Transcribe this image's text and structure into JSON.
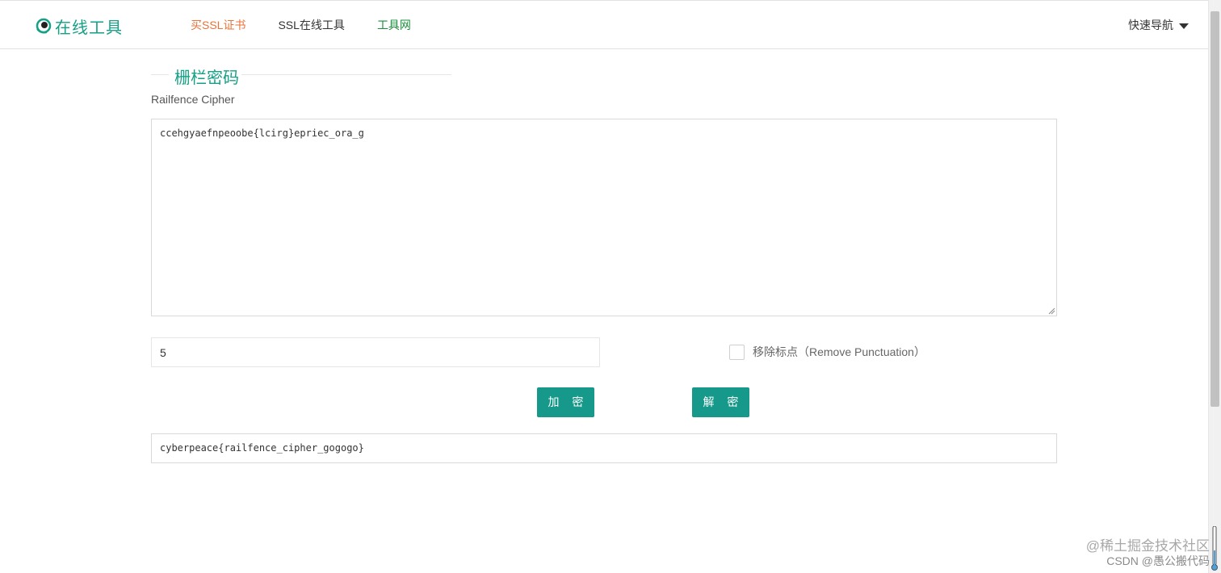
{
  "header": {
    "logo_text": "在线工具",
    "nav": [
      {
        "label": "买SSL证书",
        "color": "#e8743b"
      },
      {
        "label": "SSL在线工具",
        "color": "#333333"
      },
      {
        "label": "工具网",
        "color": "#1b8e3c"
      }
    ],
    "quick_nav_label": "快速导航"
  },
  "section": {
    "title": "栅栏密码",
    "subtitle": "Railfence Cipher"
  },
  "cipher": {
    "input_text": "ccehgyaefnpeoobe{lcirg}epriec_ora_g",
    "key_value": "5",
    "remove_punctuation_label": "移除标点（Remove Punctuation）",
    "remove_punctuation_checked": false,
    "encrypt_label": "加 密",
    "decrypt_label": "解 密",
    "output_text": "cyberpeace{railfence_cipher_gogogo}"
  },
  "watermark": {
    "line1": "@稀土掘金技术社区",
    "line2": "CSDN @愚公搬代码"
  },
  "colors": {
    "brand": "#16a085",
    "button": "#16998a",
    "nav_orange": "#e8743b",
    "nav_green": "#1b8e3c"
  }
}
